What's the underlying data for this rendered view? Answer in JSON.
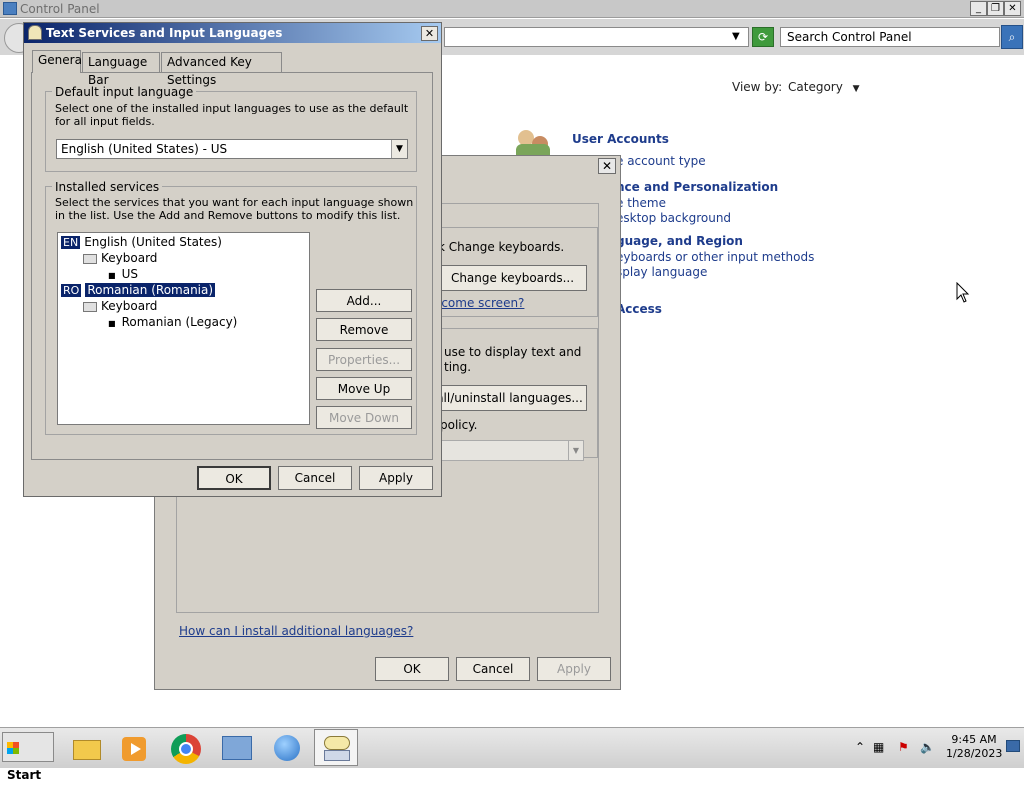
{
  "control_panel": {
    "title": "Control Panel",
    "search_placeholder": "Search Control Panel",
    "view_by_label": "View by:",
    "view_by_value": "Category",
    "user_accounts_heading": "User Accounts",
    "user_accounts_link": "e account type",
    "appearance_heading": "nce and Personalization",
    "appearance_link1": "e theme",
    "appearance_link2": "esktop background",
    "clock_heading": "guage, and Region",
    "clock_link1": "eyboards or other input methods",
    "clock_link2": "splay language",
    "access_heading": "Access"
  },
  "region_dialog": {
    "text_change_keyboards": "k Change keyboards.",
    "change_keyboards_button": "Change keyboards...",
    "welcome_link": "lcome screen?",
    "display_text_1": "use to display text and",
    "display_text_2": "ting.",
    "install_button": "all/uninstall languages...",
    "policy_text": "policy.",
    "help_link": "How can I install additional languages?",
    "ok": "OK",
    "cancel": "Cancel",
    "apply": "Apply"
  },
  "text_services": {
    "title": "Text Services and Input Languages",
    "tabs": [
      "General",
      "Language Bar",
      "Advanced Key Settings"
    ],
    "default_group_label": "Default input language",
    "default_desc": "Select one of the installed input languages to use as the default for all input fields.",
    "default_value": "English (United States) - US",
    "installed_group_label": "Installed services",
    "installed_desc": "Select the services that you want for each input language shown in the list. Use the Add and Remove buttons to modify this list.",
    "tree": {
      "en_badge": "EN",
      "en_label": "English (United States)",
      "en_keyboard": "Keyboard",
      "en_layout": "US",
      "ro_badge": "RO",
      "ro_label": "Romanian (Romania)",
      "ro_keyboard": "Keyboard",
      "ro_layout": "Romanian (Legacy)"
    },
    "buttons": {
      "add": "Add...",
      "remove": "Remove",
      "properties": "Properties...",
      "move_up": "Move Up",
      "move_down": "Move Down",
      "ok": "OK",
      "cancel": "Cancel",
      "apply": "Apply"
    }
  },
  "taskbar": {
    "start": "Start",
    "time": "9:45 AM",
    "date": "1/28/2023"
  }
}
